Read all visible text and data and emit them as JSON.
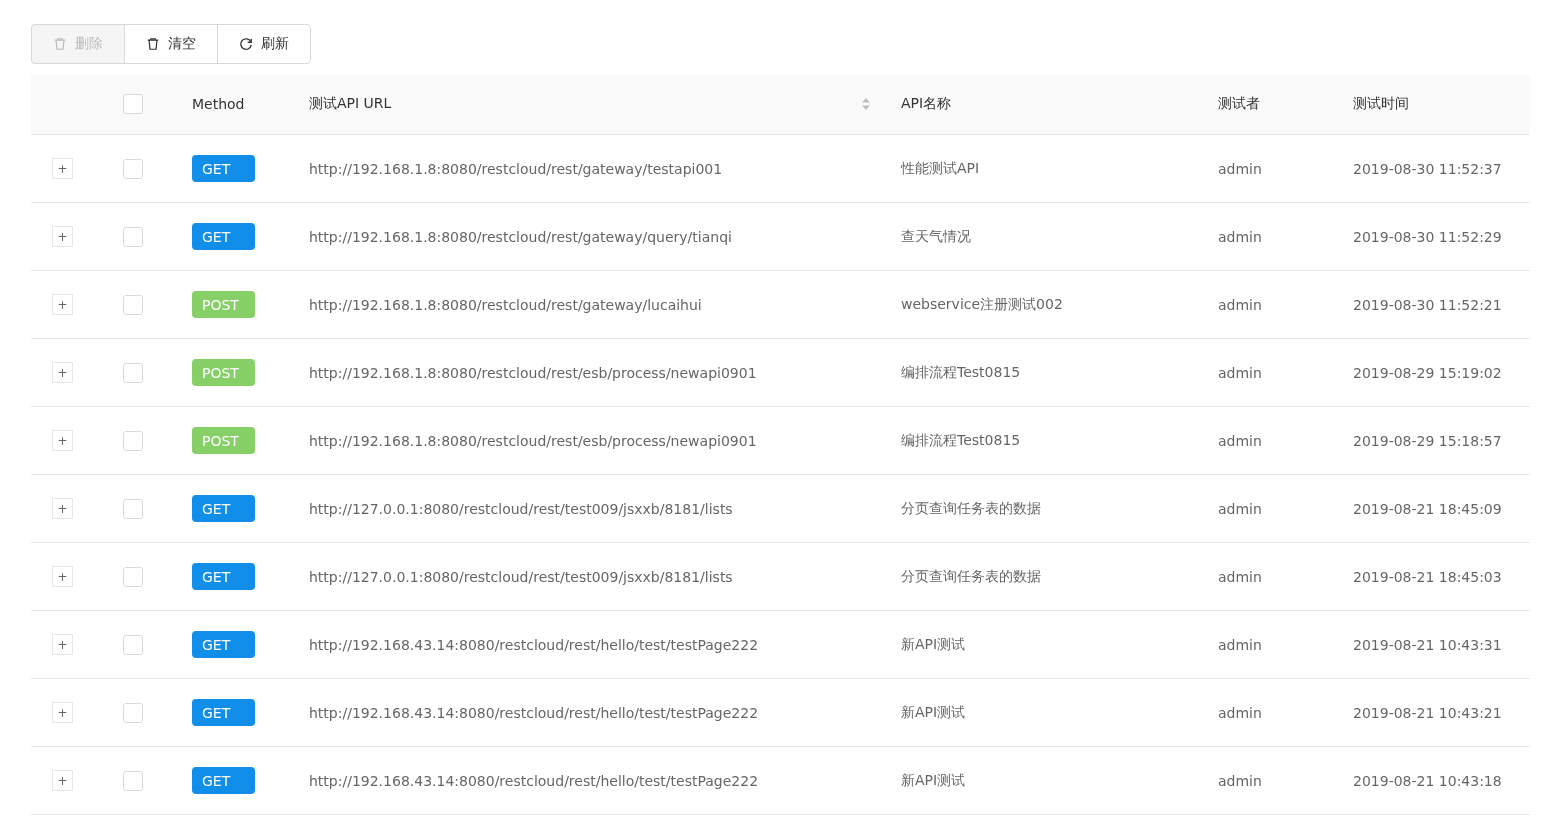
{
  "toolbar": [
    {
      "label": "删除",
      "kind": "trash",
      "disabled": true
    },
    {
      "label": "清空",
      "kind": "trash",
      "disabled": false
    },
    {
      "label": "刷新",
      "kind": "refresh",
      "disabled": false
    }
  ],
  "table": {
    "select_all": {
      "checked": false
    },
    "columns": [
      {
        "label": "Method",
        "sortable": false
      },
      {
        "label": "测试API URL",
        "sortable": true
      },
      {
        "label": "API名称",
        "sortable": false
      },
      {
        "label": "测试者",
        "sortable": false
      },
      {
        "label": "测试时间",
        "sortable": false
      }
    ],
    "rows": [
      {
        "expander": "+",
        "expanded": false,
        "checked": false,
        "method": "GET",
        "kind": "get",
        "url": "http://192.168.1.8:8080/restcloud/rest/gateway/testapi001",
        "name": "性能测试API",
        "tester": "admin",
        "time": "2019-08-30 11:52:37"
      },
      {
        "expander": "+",
        "expanded": false,
        "checked": false,
        "method": "GET",
        "kind": "get",
        "url": "http://192.168.1.8:8080/restcloud/rest/gateway/query/tianqi",
        "name": "查天气情况",
        "tester": "admin",
        "time": "2019-08-30 11:52:29"
      },
      {
        "expander": "+",
        "expanded": false,
        "checked": false,
        "method": "POST",
        "kind": "post",
        "url": "http://192.168.1.8:8080/restcloud/rest/gateway/lucaihui",
        "name": "webservice注册测试002",
        "tester": "admin",
        "time": "2019-08-30 11:52:21"
      },
      {
        "expander": "+",
        "expanded": false,
        "checked": false,
        "method": "POST",
        "kind": "post",
        "url": "http://192.168.1.8:8080/restcloud/rest/esb/process/newapi0901",
        "name": "编排流程Test0815",
        "tester": "admin",
        "time": "2019-08-29 15:19:02"
      },
      {
        "expander": "+",
        "expanded": false,
        "checked": false,
        "method": "POST",
        "kind": "post",
        "url": "http://192.168.1.8:8080/restcloud/rest/esb/process/newapi0901",
        "name": "编排流程Test0815",
        "tester": "admin",
        "time": "2019-08-29 15:18:57"
      },
      {
        "expander": "+",
        "expanded": false,
        "checked": false,
        "method": "GET",
        "kind": "get",
        "url": "http://127.0.0.1:8080/restcloud/rest/test009/jsxxb/8181/lists",
        "name": "分页查询任务表的数据",
        "tester": "admin",
        "time": "2019-08-21 18:45:09"
      },
      {
        "expander": "+",
        "expanded": false,
        "checked": false,
        "method": "GET",
        "kind": "get",
        "url": "http://127.0.0.1:8080/restcloud/rest/test009/jsxxb/8181/lists",
        "name": "分页查询任务表的数据",
        "tester": "admin",
        "time": "2019-08-21 18:45:03"
      },
      {
        "expander": "+",
        "expanded": false,
        "checked": false,
        "method": "GET",
        "kind": "get",
        "url": "http://192.168.43.14:8080/restcloud/rest/hello/test/testPage222",
        "name": "新API测试",
        "tester": "admin",
        "time": "2019-08-21 10:43:31"
      },
      {
        "expander": "+",
        "expanded": false,
        "checked": false,
        "method": "GET",
        "kind": "get",
        "url": "http://192.168.43.14:8080/restcloud/rest/hello/test/testPage222",
        "name": "新API测试",
        "tester": "admin",
        "time": "2019-08-21 10:43:21"
      },
      {
        "expander": "+",
        "expanded": false,
        "checked": false,
        "method": "GET",
        "kind": "get",
        "url": "http://192.168.43.14:8080/restcloud/rest/hello/test/testPage222",
        "name": "新API测试",
        "tester": "admin",
        "time": "2019-08-21 10:43:18"
      }
    ]
  }
}
